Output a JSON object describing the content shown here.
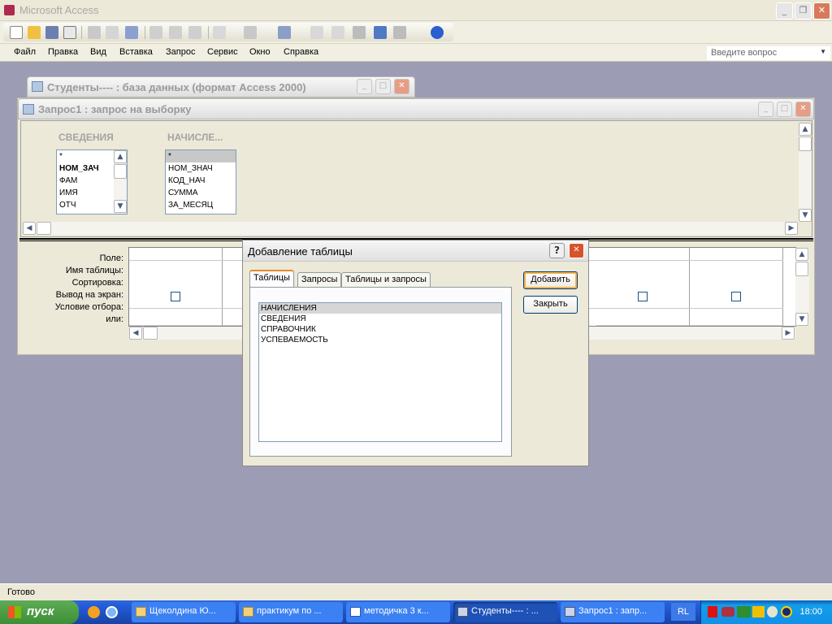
{
  "app": {
    "title": "Microsoft Access"
  },
  "menu": [
    "Файл",
    "Правка",
    "Вид",
    "Вставка",
    "Запрос",
    "Сервис",
    "Окно",
    "Справка"
  ],
  "ask": {
    "placeholder": "Введите вопрос"
  },
  "dbwin": {
    "title": "Студенты---- : база данных (формат Access 2000)"
  },
  "qwin": {
    "title": "Запрос1 : запрос на выборку"
  },
  "tables": [
    {
      "name": "СВЕДЕНИЯ",
      "fields": [
        "*",
        "НОМ_ЗАЧ",
        "ФАМ",
        "ИМЯ",
        "ОТЧ"
      ]
    },
    {
      "name": "НАЧИСЛЕ...",
      "fields": [
        "*",
        "НОМ_ЗНАЧ",
        "КОД_НАЧ",
        "СУММА",
        "ЗА_МЕСЯЦ"
      ]
    }
  ],
  "grid": {
    "labels": [
      "Поле:",
      "Имя таблицы:",
      "Сортировка:",
      "Вывод на экран:",
      "Условие отбора:",
      "или:"
    ]
  },
  "dialog": {
    "title": "Добавление таблицы",
    "help": "?",
    "tabs": [
      "Таблицы",
      "Запросы",
      "Таблицы и запросы"
    ],
    "items": [
      "НАЧИСЛЕНИЯ",
      "СВЕДЕНИЯ",
      "СПРАВОЧНИК",
      "УСПЕВАЕМОСТЬ"
    ],
    "add_label": "Добавить",
    "close_label": "Закрыть"
  },
  "status": "Готово",
  "taskbar": {
    "start": "пуск",
    "tasks": [
      "Щеколдина Ю...",
      "практикум по ...",
      "методичка 3 к...",
      "Студенты---- : ...",
      "Запрос1 : запр..."
    ],
    "lang": "RL",
    "clock": "18:00"
  },
  "colors": {
    "desktop": "#9c9cb4",
    "taskbar": "#245edb",
    "start": "#3c8f36",
    "selection": "#d6d6d6"
  }
}
